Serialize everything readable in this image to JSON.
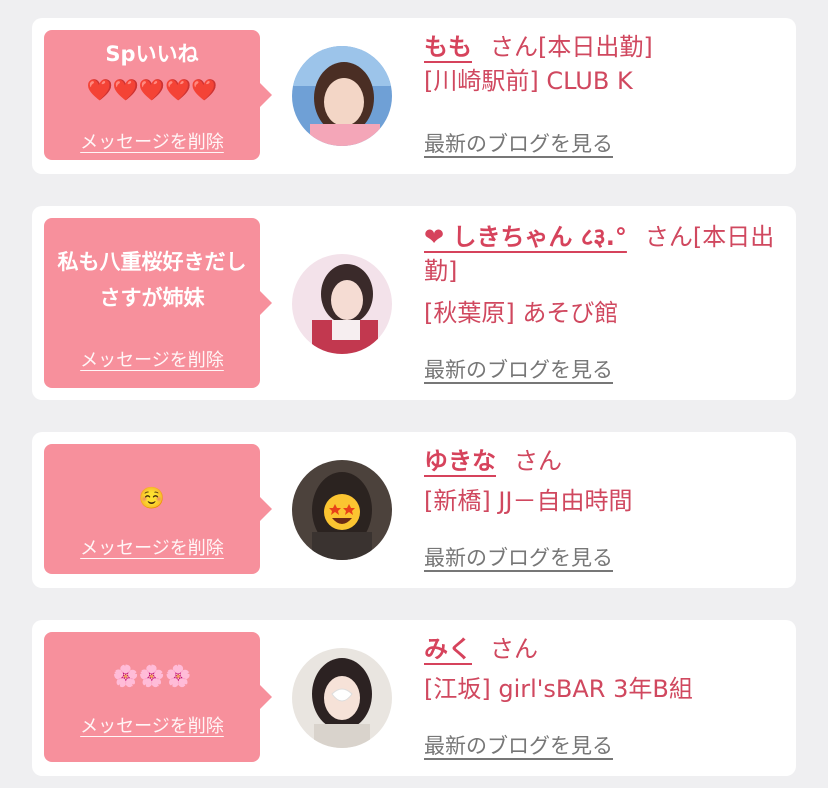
{
  "items": [
    {
      "message": "Spいいね\n❤️❤️❤️❤️❤️",
      "delete_label": "メッセージを削除",
      "name": "もも",
      "honorific": "さん[本日出勤]",
      "shop": "[川崎駅前] CLUB K",
      "blog_label": "最新のブログを見る"
    },
    {
      "message": "私も八重桜好きだしさすが姉妹",
      "delete_label": "メッセージを削除",
      "name": "❤︎ しきちゃん ८३.°",
      "honorific": "さん[本日出勤]",
      "shop": "[秋葉原] あそび館",
      "blog_label": "最新のブログを見る"
    },
    {
      "message": "☺️",
      "delete_label": "メッセージを削除",
      "name": "ゆきな",
      "honorific": "さん",
      "shop": "[新橋] JJ－自由時間",
      "blog_label": "最新のブログを見る"
    },
    {
      "message": "🌸🌸🌸",
      "delete_label": "メッセージを削除",
      "name": "みく",
      "honorific": "さん",
      "shop": "[江坂] girl'sBAR 3年B組",
      "blog_label": "最新のブログを見る"
    }
  ],
  "colors": {
    "background": "#efeff1",
    "bubble": "#f7909c",
    "name": "#d6435c",
    "text": "#d0485f",
    "link_gray": "#777777"
  },
  "icons": [
    "heart-icon",
    "smiling-face-icon",
    "cherry-blossom-icon",
    "star-struck-face-icon"
  ]
}
